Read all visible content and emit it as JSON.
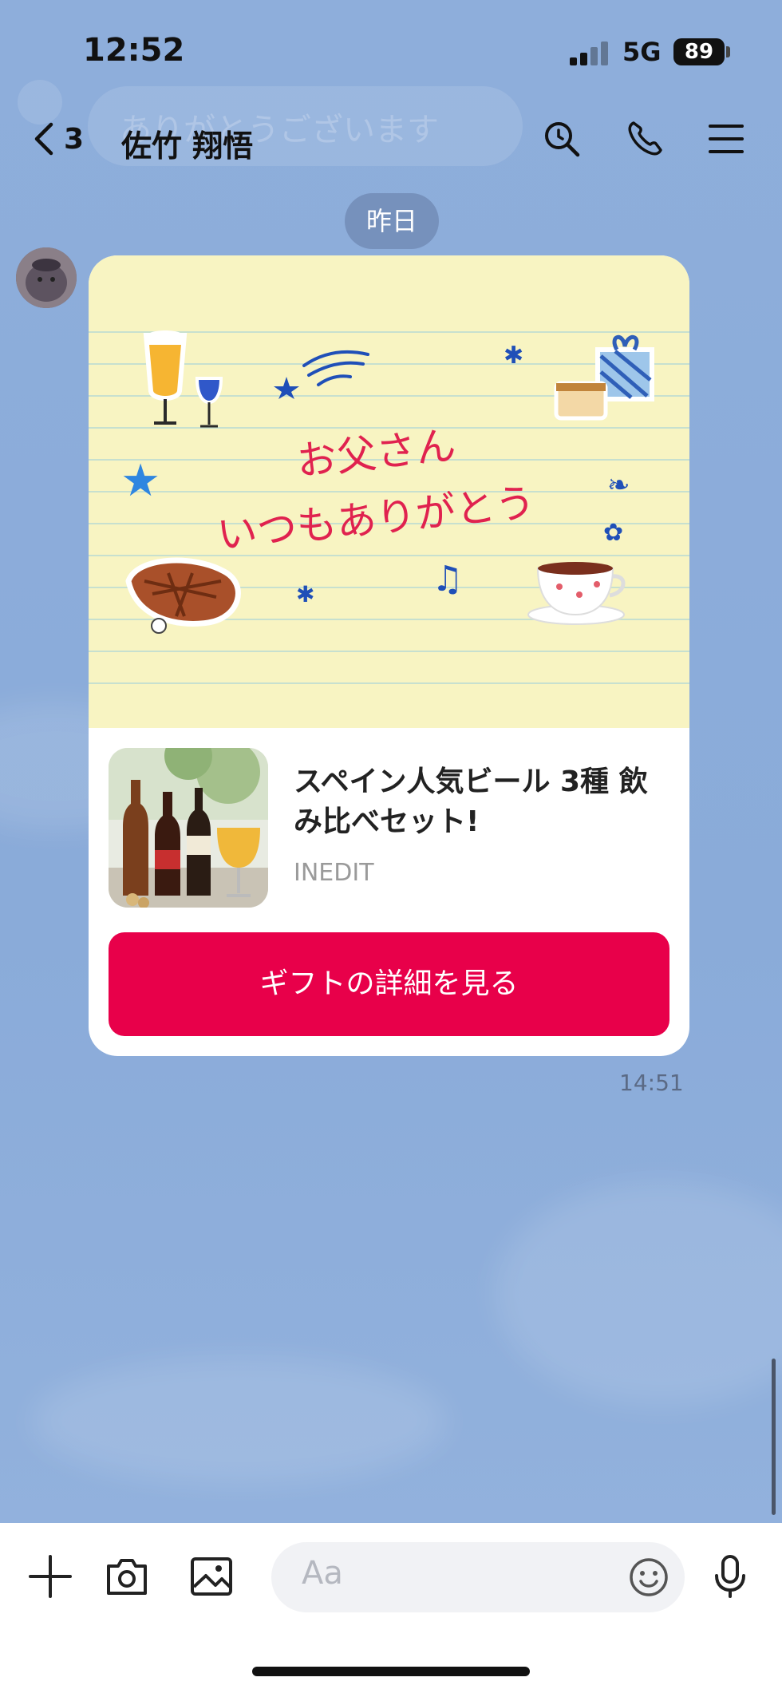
{
  "status_bar": {
    "time": "12:52",
    "network": "5G",
    "battery": "89"
  },
  "preview_banner": {
    "text": "ありがとうございます"
  },
  "header": {
    "back_count": "3",
    "contact_name": "佐竹 翔悟"
  },
  "chat": {
    "date_label": "昨日",
    "gift_card": {
      "message_line1": "お父さん",
      "message_line2": "いつもありがとう",
      "product_title": "スペイン人気ビール 3種 飲み比べセット!",
      "brand": "INEDIT",
      "cta_label": "ギフトの詳細を見る"
    },
    "timestamp": "14:51"
  },
  "composer": {
    "placeholder": "Aa"
  },
  "colors": {
    "cta": "#e8004a",
    "handwriting": "#e0224f",
    "background": "#8eaedb",
    "notepaper": "#f8f4c2"
  },
  "icons": [
    "back-chevron-icon",
    "search-icon",
    "phone-icon",
    "menu-icon",
    "plus-icon",
    "camera-icon",
    "image-icon",
    "emoji-icon",
    "mic-icon"
  ]
}
